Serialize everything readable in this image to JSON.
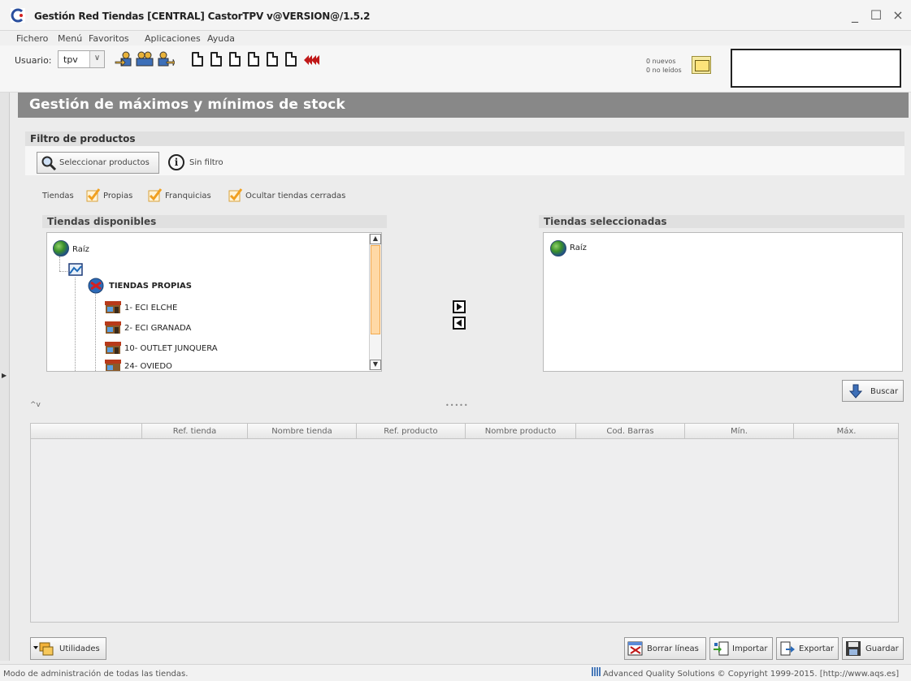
{
  "window": {
    "title": "Gestión Red Tiendas [CENTRAL] CastorTPV v@VERSION@/1.5.2",
    "controls": [
      "_",
      "☐",
      "×"
    ]
  },
  "menu": [
    "Fichero",
    "Menú",
    "Favoritos",
    "Aplicaciones",
    "Ayuda"
  ],
  "toolbar": {
    "user_label": "Usuario:",
    "user_value": "tpv",
    "messages_line1": "0 nuevos",
    "messages_line2": "0 no leídos"
  },
  "page": {
    "title": "Gestión de máximos y mínimos de stock",
    "filter_header": "Filtro de productos",
    "select_products": "Seleccionar productos",
    "no_filter": "Sin filtro",
    "stores_label": "Tiendas",
    "checks": [
      {
        "label": "Propias",
        "checked": true
      },
      {
        "label": "Franquicias",
        "checked": true
      },
      {
        "label": "Ocultar tiendas cerradas",
        "checked": true
      }
    ],
    "available_title": "Tiendas disponibles",
    "selected_title": "Tiendas seleccionadas",
    "tree": {
      "root": "Raíz",
      "group": "TIENDAS PROPIAS",
      "stores": [
        "1- ECI ELCHE",
        "2- ECI GRANADA",
        "10- OUTLET JUNQUERA",
        "24- OVIEDO"
      ]
    },
    "selected_root": "Raíz",
    "search_button": "Buscar",
    "columns": [
      "Ref. tienda",
      "Nombre tienda",
      "Ref. producto",
      "Nombre producto",
      "Cod. Barras",
      "Mín.",
      "Máx."
    ]
  },
  "buttons": {
    "utilities": "Utilidades",
    "clear_lines": "Borrar líneas",
    "import": "Importar",
    "export": "Exportar",
    "save": "Guardar"
  },
  "status": {
    "left": "Modo de administración de todas las tiendas.",
    "right": "Advanced Quality Solutions © Copyright 1999-2015. [http://www.aqs.es]"
  }
}
